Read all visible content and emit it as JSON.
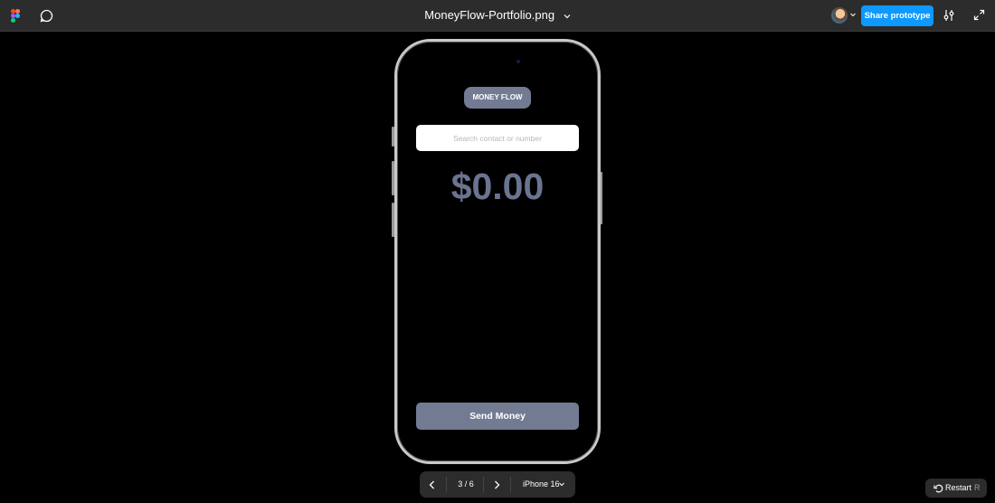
{
  "toolbar": {
    "file_title": "MoneyFlow-Portfolio.png",
    "share_label": "Share prototype",
    "icons": [
      "figma-logo-icon",
      "comment-icon",
      "chevron-down-icon",
      "avatar",
      "settings-sliders-icon",
      "expand-icon"
    ],
    "accent": "#0d99ff"
  },
  "app": {
    "brand_label": "MONEY FLOW",
    "search_placeholder": "Search contact or number",
    "amount": "$0.00",
    "send_label": "Send Money",
    "brand_color": "#737b93",
    "amount_color": "#6a7490"
  },
  "prototype_nav": {
    "page_count": "3 / 6",
    "device": "iPhone 16"
  },
  "restart": {
    "label": "Restart",
    "shortcut": "R"
  }
}
